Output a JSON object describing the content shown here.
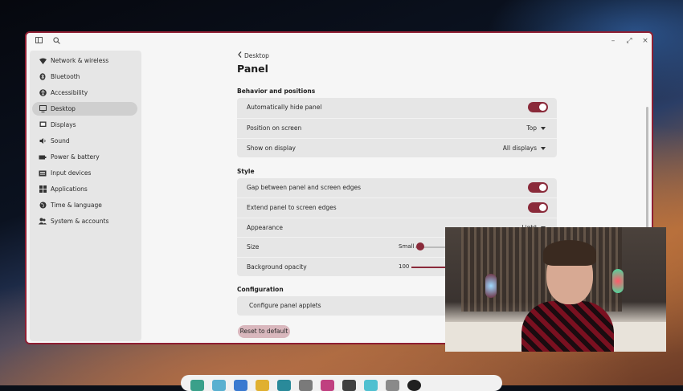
{
  "window": {
    "controls": {
      "minimize": "–",
      "maximize": "⤢",
      "close": "×"
    }
  },
  "sidebar": {
    "items": [
      {
        "label": "Network & wireless",
        "icon": "wifi-icon",
        "active": false
      },
      {
        "label": "Bluetooth",
        "icon": "bluetooth-icon",
        "active": false
      },
      {
        "label": "Accessibility",
        "icon": "accessibility-icon",
        "active": false
      },
      {
        "label": "Desktop",
        "icon": "monitor-icon",
        "active": true
      },
      {
        "label": "Displays",
        "icon": "display-icon",
        "active": false
      },
      {
        "label": "Sound",
        "icon": "speaker-icon",
        "active": false
      },
      {
        "label": "Power & battery",
        "icon": "battery-icon",
        "active": false
      },
      {
        "label": "Input devices",
        "icon": "keyboard-icon",
        "active": false
      },
      {
        "label": "Applications",
        "icon": "grid-icon",
        "active": false
      },
      {
        "label": "Time & language",
        "icon": "globe-icon",
        "active": false
      },
      {
        "label": "System & accounts",
        "icon": "users-icon",
        "active": false
      }
    ]
  },
  "main": {
    "breadcrumb": "Desktop",
    "title": "Panel",
    "sections": {
      "behavior": {
        "title": "Behavior and positions",
        "auto_hide": {
          "label": "Automatically hide panel",
          "on": true
        },
        "position": {
          "label": "Position on screen",
          "value": "Top"
        },
        "show_on": {
          "label": "Show on display",
          "value": "All displays"
        }
      },
      "style": {
        "title": "Style",
        "gap": {
          "label": "Gap between panel and screen edges",
          "on": true
        },
        "extend": {
          "label": "Extend panel to screen edges",
          "on": true
        },
        "appearance": {
          "label": "Appearance",
          "value": "Light"
        },
        "size": {
          "label": "Size",
          "value": "Small"
        },
        "opacity": {
          "label": "Background opacity",
          "value": "100"
        }
      },
      "configuration": {
        "title": "Configuration",
        "applets": {
          "label": "Configure panel applets"
        }
      }
    },
    "reset_label": "Reset to default"
  },
  "colors": {
    "accent": "#8a2a3a",
    "window_border": "#8f1f33"
  }
}
